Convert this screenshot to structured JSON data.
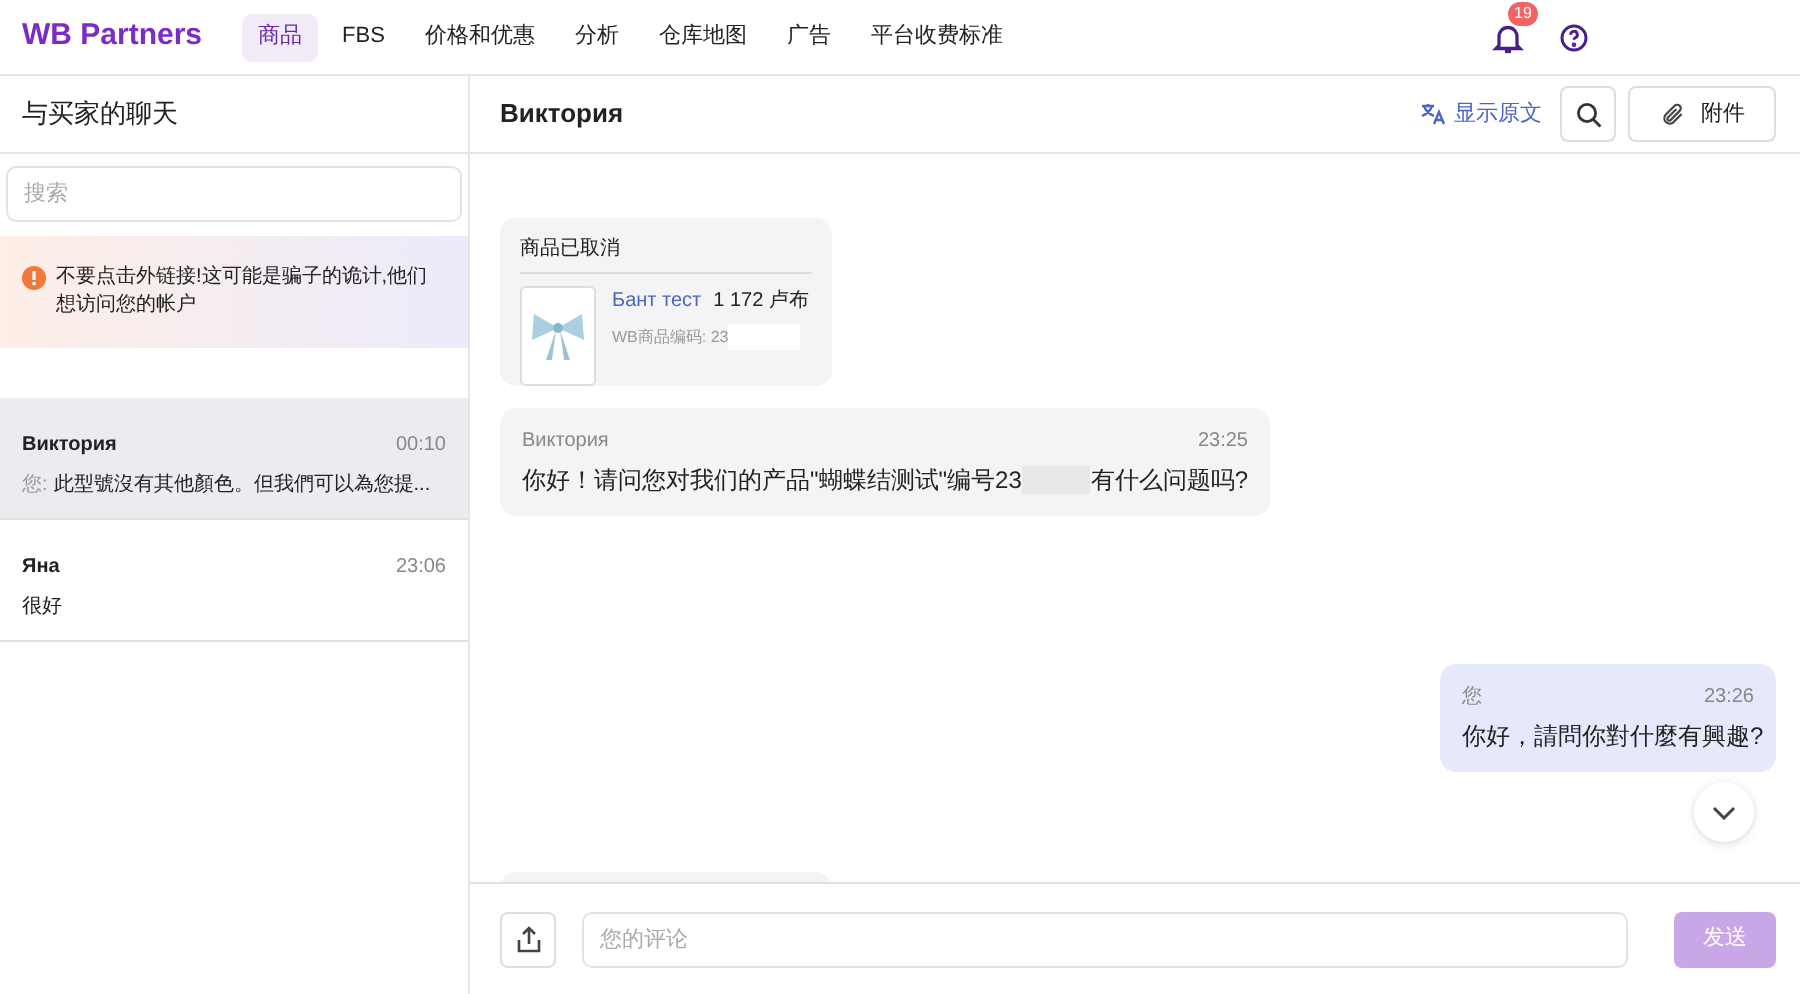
{
  "header": {
    "logo": "WB Partners",
    "nav": [
      {
        "label": "商品",
        "selected": true
      },
      {
        "label": "FBS",
        "selected": false
      },
      {
        "label": "价格和优惠",
        "selected": false
      },
      {
        "label": "分析",
        "selected": false
      },
      {
        "label": "仓库地图",
        "selected": false
      },
      {
        "label": "广告",
        "selected": false
      },
      {
        "label": "平台收费标准",
        "selected": false
      }
    ],
    "notifications_count": "19"
  },
  "sidebar": {
    "title": "与买家的聊天",
    "search": {
      "placeholder": "搜索"
    },
    "warning": "不要点击外链接!这可能是骗子的诡计,他们想访问您的帐户",
    "chats": [
      {
        "name": "Виктория",
        "time": "00:10",
        "prefix": "您:",
        "preview": "此型號沒有其他顏色。但我們可以為您提...",
        "selected": true
      },
      {
        "name": "Яна",
        "time": "23:06",
        "preview": "很好",
        "selected": false
      }
    ]
  },
  "chat": {
    "title": "Виктория",
    "translate": "显示原文",
    "attach": "附件",
    "messages": [
      {
        "kind": "product",
        "status": "商品已取消",
        "product_name": "Бант тест",
        "price": "1 172 卢布",
        "code": "WB商品编码: 23"
      },
      {
        "kind": "incoming",
        "author": "Виктория",
        "time": "23:25",
        "text_before": "你好！请问您对我们的产品\"蝴蝶结测试\"编号23",
        "text_after": "有什么问题吗?"
      },
      {
        "kind": "outgoing",
        "author": "您",
        "time": "23:26",
        "text": "你好，請問你對什麼有興趣?"
      },
      {
        "kind": "product_cut"
      }
    ],
    "composer": {
      "placeholder": "您的评论",
      "send": "发送"
    }
  }
}
